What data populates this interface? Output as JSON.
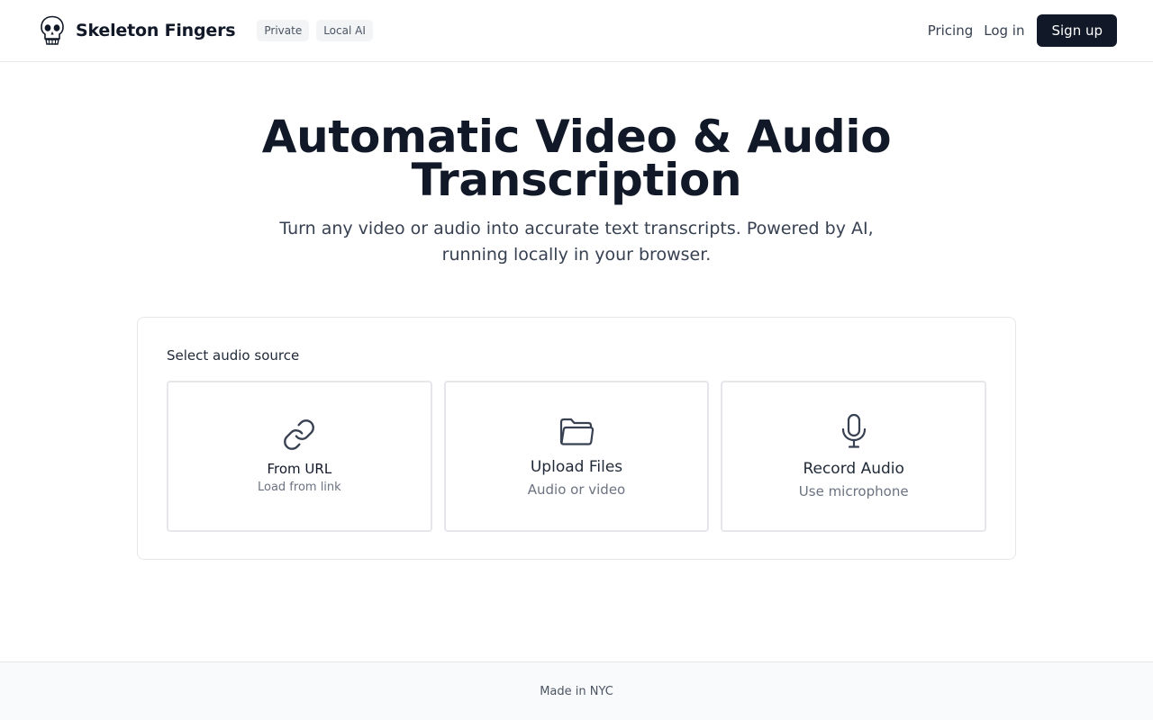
{
  "header": {
    "brand_name": "Skeleton Fingers",
    "logo_icon": "skull-icon",
    "badges": [
      "Private",
      "Local AI"
    ],
    "nav": {
      "pricing": "Pricing",
      "login": "Log in",
      "signup": "Sign up"
    }
  },
  "hero": {
    "title": "Automatic Video & Audio Transcription",
    "subtitle": "Turn any video or audio into accurate text transcripts. Powered by AI, running locally in your browser."
  },
  "source_panel": {
    "label": "Select audio source",
    "options": [
      {
        "icon": "link-icon",
        "title": "From URL",
        "subtitle": "Load from link"
      },
      {
        "icon": "folder-icon",
        "title": "Upload Files",
        "subtitle": "Audio or video"
      },
      {
        "icon": "microphone-icon",
        "title": "Record Audio",
        "subtitle": "Use microphone"
      }
    ]
  },
  "footer": {
    "text": "Made in NYC"
  },
  "colors": {
    "primary": "#111827",
    "border": "#e5e7eb",
    "muted_text": "#6b7280",
    "badge_bg": "#f3f4f6",
    "footer_bg": "#f9fafb"
  }
}
